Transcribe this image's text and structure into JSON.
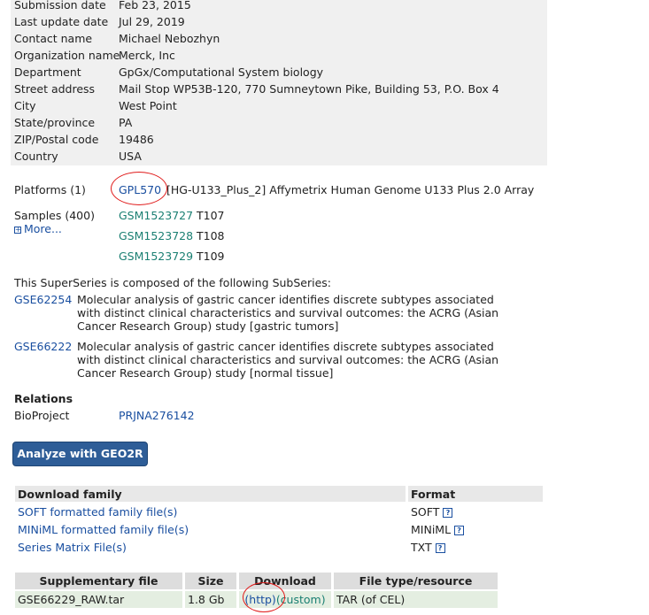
{
  "info": [
    {
      "label": "Submission date",
      "value": "Feb 23, 2015"
    },
    {
      "label": "Last update date",
      "value": "Jul 29, 2019"
    },
    {
      "label": "Contact name",
      "value": "Michael Nebozhyn"
    },
    {
      "label": "Organization name",
      "value": "Merck, Inc"
    },
    {
      "label": "Department",
      "value": "GpGx/Computational System biology"
    },
    {
      "label": "Street address",
      "value": "Mail Stop WP53B-120, 770 Sumneytown Pike, Building 53, P.O. Box 4"
    },
    {
      "label": "City",
      "value": "West Point"
    },
    {
      "label": "State/province",
      "value": "PA"
    },
    {
      "label": "ZIP/Postal code",
      "value": "19486"
    },
    {
      "label": "Country",
      "value": "USA"
    }
  ],
  "platforms": {
    "label": "Platforms (1)",
    "id": "GPL570",
    "desc": "[HG-U133_Plus_2] Affymetrix Human Genome U133 Plus 2.0 Array"
  },
  "samples": {
    "label": "Samples (400)",
    "more": "More...",
    "items": [
      {
        "id": "GSM1523727",
        "name": "T107"
      },
      {
        "id": "GSM1523728",
        "name": "T108"
      },
      {
        "id": "GSM1523729",
        "name": "T109"
      }
    ]
  },
  "superseries": {
    "intro": "This SuperSeries is composed of the following SubSeries:",
    "items": [
      {
        "id": "GSE62254",
        "desc": "Molecular analysis of gastric cancer identifies discrete subtypes associated with distinct clinical characteristics and survival outcomes: the ACRG (Asian Cancer Research Group) study [gastric tumors]"
      },
      {
        "id": "GSE66222",
        "desc": "Molecular analysis of gastric cancer identifies discrete subtypes associated with distinct clinical characteristics and survival outcomes: the ACRG (Asian Cancer Research Group) study [normal tissue]"
      }
    ]
  },
  "relations": {
    "heading": "Relations",
    "label": "BioProject",
    "value": "PRJNA276142"
  },
  "analyze_button": "Analyze with GEO2R",
  "download": {
    "headers": [
      "Download family",
      "Format"
    ],
    "rows": [
      {
        "name": "SOFT formatted family file(s)",
        "format": "SOFT"
      },
      {
        "name": "MINiML formatted family file(s)",
        "format": "MINiML"
      },
      {
        "name": "Series Matrix File(s)",
        "format": "TXT"
      }
    ],
    "help_icon": "?"
  },
  "supplementary": {
    "headers": [
      "Supplementary file",
      "Size",
      "Download",
      "File type/resource"
    ],
    "row": {
      "file": "GSE66229_RAW.tar",
      "size": "1.8 Gb",
      "http": "(http)",
      "custom": "(custom)",
      "type": "TAR (of CEL)"
    }
  },
  "colors": {
    "link": "#1a4fa0",
    "sample_link": "#1a7f72",
    "annotation": "#e01919",
    "button": "#2e5d97"
  }
}
